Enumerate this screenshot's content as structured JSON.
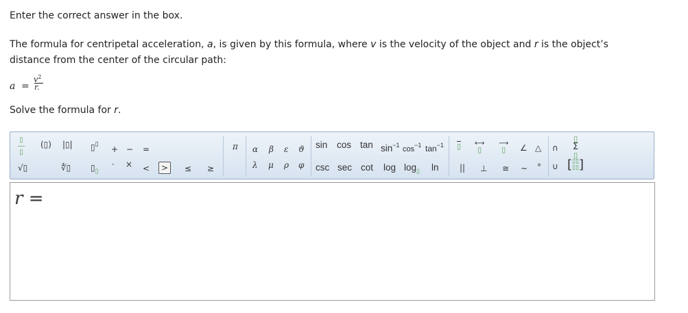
{
  "question": {
    "instruction": "Enter the correct answer in the box.",
    "intro": "The formula for centripetal acceleration, ",
    "var_a": "a",
    "mid1": ", is given by this formula, where ",
    "var_v": "v",
    "mid2": " is the velocity of the object and ",
    "var_r": "r",
    "mid3": " is the object’s distance from the center of the circular path:",
    "formula": {
      "lhs": "a",
      "eq": "=",
      "numerator": "v",
      "exponent": "2",
      "denominator": "r."
    },
    "solve_prefix": "Solve the formula for ",
    "solve_var": "r",
    "solve_suffix": "."
  },
  "toolbar": {
    "fraction": "▯/▯",
    "paren": "(▯)",
    "abs": "|▯|",
    "power": "▯▯",
    "sqrt": "√▯",
    "nthroot": "∜▯",
    "subscript": "▯▯",
    "plus": "+",
    "minus": "−",
    "equals": "=",
    "cdot": "·",
    "times": "×",
    "lt": "<",
    "gt": ">",
    "le": "≤",
    "ge": "≥",
    "pi": "π",
    "alpha": "α",
    "beta": "β",
    "epsilon": "ε",
    "theta": "ϑ",
    "lambda": "λ",
    "mu": "μ",
    "rho": "ρ",
    "phi": "φ",
    "sin": "sin",
    "cos": "cos",
    "tan": "tan",
    "arcsin": "sin",
    "arccos": "cos",
    "arctan": "tan",
    "inv_exp": "−1",
    "csc": "csc",
    "sec": "sec",
    "cot": "cot",
    "log": "log",
    "logb": "log",
    "ln": "ln",
    "overline": "▯",
    "line": "⟷",
    "ray": "⟶",
    "angle": "∠",
    "triangle": "△",
    "intersect": "∩",
    "sum": "Σ",
    "parallel": "||",
    "perp": "⊥",
    "congruent": "≅",
    "similar": "~",
    "degree": "°",
    "union": "∪",
    "matrix": "[▯▯ / ▯▯]"
  },
  "answer": {
    "label": "r =",
    "var": "r",
    "eq": "=",
    "value": ""
  }
}
